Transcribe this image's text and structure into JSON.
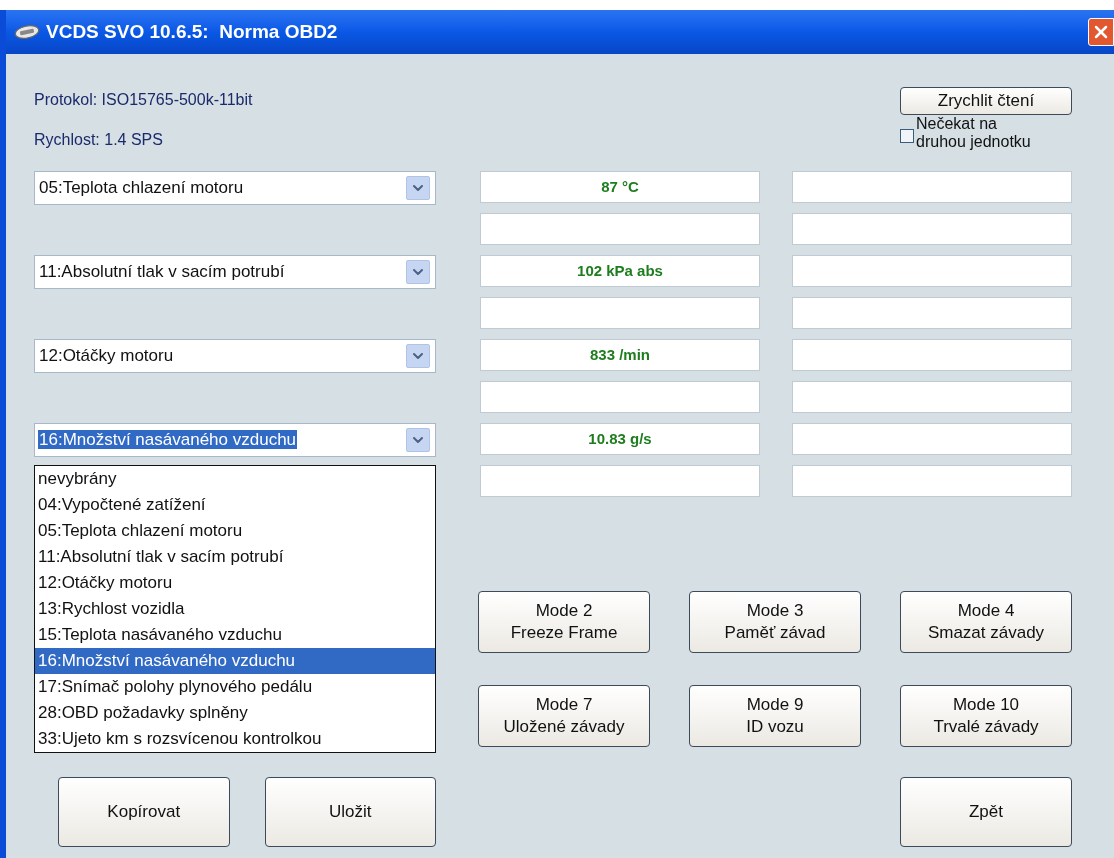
{
  "window": {
    "title": "VCDS SVO 10.6.5:  Norma OBD2"
  },
  "protocol": "Protokol: ISO15765-500k-11bit",
  "speed": "Rychlost: 1.4 SPS",
  "fast_read_button": "Zrychlit čtení",
  "no_wait_checkbox": {
    "label_lines": [
      "Nečekat na",
      "druhou jednotku"
    ],
    "checked": false
  },
  "channels": [
    {
      "value": "05:Teplota chlazení motoru",
      "focused": false,
      "readings": [
        "87 °C"
      ]
    },
    {
      "value": "11:Absolutní tlak v sacím potrubí",
      "focused": false,
      "readings": [
        "102 kPa abs"
      ]
    },
    {
      "value": "12:Otáčky motoru",
      "focused": false,
      "readings": [
        "833 /min"
      ]
    },
    {
      "value": "16:Množství nasávaného vzduchu",
      "focused": true,
      "readings": [
        "10.83 g/s"
      ]
    }
  ],
  "dropdown": {
    "items": [
      {
        "label": "nevybrány",
        "selected": false
      },
      {
        "label": "04:Vypočtené zatížení",
        "selected": false
      },
      {
        "label": "05:Teplota chlazení motoru",
        "selected": false
      },
      {
        "label": "11:Absolutní tlak v sacím potrubí",
        "selected": false
      },
      {
        "label": "12:Otáčky motoru",
        "selected": false
      },
      {
        "label": "13:Rychlost vozidla",
        "selected": false
      },
      {
        "label": "15:Teplota nasávaného vzduchu",
        "selected": false
      },
      {
        "label": "16:Množství nasávaného vzduchu",
        "selected": true
      },
      {
        "label": "17:Snímač polohy plynového pedálu",
        "selected": false
      },
      {
        "label": "28:OBD požadavky splněny",
        "selected": false
      },
      {
        "label": "33:Ujeto km s rozsvícenou kontrolkou",
        "selected": false
      }
    ]
  },
  "mode_buttons": [
    {
      "mode": "Mode 2",
      "label": "Freeze Frame"
    },
    {
      "mode": "Mode 3",
      "label": "Paměť závad"
    },
    {
      "mode": "Mode 4",
      "label": "Smazat závady"
    },
    {
      "mode": "Mode 7",
      "label": "Uložené závady"
    },
    {
      "mode": "Mode 9",
      "label": "ID vozu"
    },
    {
      "mode": "Mode 10",
      "label": "Trvalé závady"
    }
  ],
  "bottom_buttons": [
    "Kopírovat",
    "Uložit"
  ],
  "back_button": "Zpět"
}
